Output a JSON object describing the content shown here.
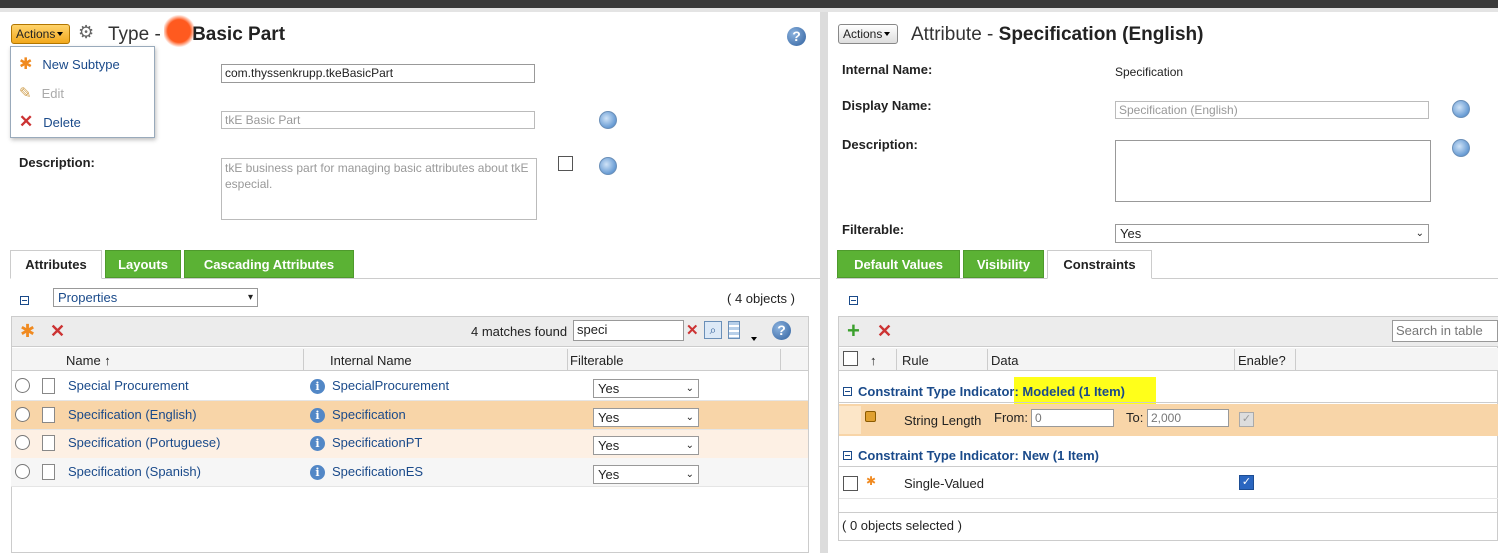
{
  "left": {
    "actions_label": "Actions",
    "title_prefix": "Type - ",
    "title_name": "Basic Part",
    "menu": [
      {
        "label": "New Subtype",
        "icon": "star-icon"
      },
      {
        "label": "Edit",
        "icon": "pencil-icon",
        "disabled": true
      },
      {
        "label": "Delete",
        "icon": "delete-icon"
      }
    ],
    "internal_name_value": "com.thyssenkrupp.tkeBasicPart",
    "display_name_value": "tkE Basic Part",
    "description_label": "Description:",
    "description_value": "tkE business part for managing basic attributes about tkE especial.",
    "tabs": [
      "Attributes",
      "Layouts",
      "Cascading Attributes"
    ],
    "view_select": "Properties",
    "object_count": "( 4 objects )",
    "matches_found": "4 matches found",
    "search_value": "speci",
    "columns": [
      "Name ↑",
      "Internal Name",
      "Filterable"
    ],
    "rows": [
      {
        "name": "Special Procurement",
        "internal": "SpecialProcurement",
        "filterable": "Yes"
      },
      {
        "name": "Specification (English)",
        "internal": "Specification",
        "filterable": "Yes"
      },
      {
        "name": "Specification (Portuguese)",
        "internal": "SpecificationPT",
        "filterable": "Yes"
      },
      {
        "name": "Specification (Spanish)",
        "internal": "SpecificationES",
        "filterable": "Yes"
      }
    ]
  },
  "right": {
    "actions_label": "Actions",
    "title_prefix": "Attribute - ",
    "title_name": "Specification (English)",
    "internal_name_label": "Internal Name:",
    "internal_name_value": "Specification",
    "display_name_label": "Display Name:",
    "display_name_value": "Specification (English)",
    "description_label": "Description:",
    "filterable_label": "Filterable:",
    "filterable_value": "Yes",
    "tabs": [
      "Default Values",
      "Visibility",
      "Constraints"
    ],
    "search_placeholder": "Search in table",
    "columns": [
      "↑",
      "Rule",
      "Data",
      "Enable?"
    ],
    "group1": "Constraint Type Indicator: Modeled (1 Item)",
    "group1_row": {
      "rule": "String Length",
      "from_label": "From:",
      "from_value": "0",
      "to_label": "To:",
      "to_value": "2,000"
    },
    "group2": "Constraint Type Indicator: New (1 Item)",
    "group2_row": {
      "rule": "Single-Valued"
    },
    "selected_count": "( 0 objects selected )"
  },
  "colors": {
    "accent_green": "#5bb234",
    "selected_row": "#f8d5a8",
    "link": "#1a4a8a",
    "highlight": "#ffff1a"
  }
}
